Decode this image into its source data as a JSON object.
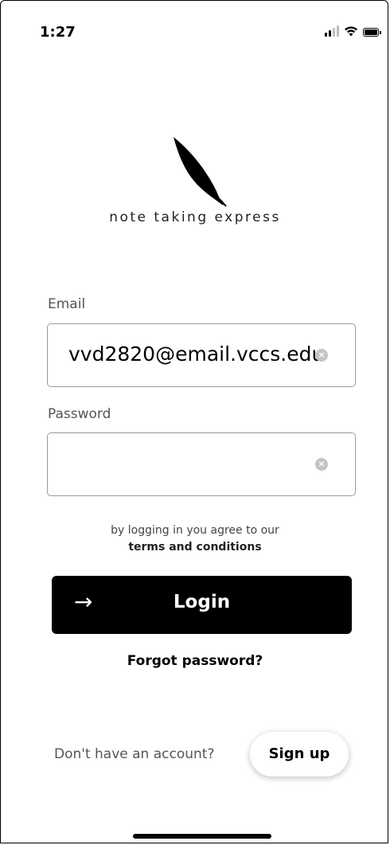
{
  "status_bar": {
    "time": "1:27"
  },
  "brand": {
    "name": "note taking express"
  },
  "form": {
    "email_label": "Email",
    "email_value": "vvd2820@email.vccs.edu",
    "password_label": "Password",
    "password_value": "",
    "clear_icon": "x-circle-icon"
  },
  "terms": {
    "prefix": "by logging in you agree to our",
    "link": "terms and conditions"
  },
  "actions": {
    "login_label": "Login",
    "login_icon": "arrow-right-icon",
    "forgot_label": "Forgot password?",
    "no_account_text": "Don't have an account?",
    "signup_label": "Sign up"
  }
}
